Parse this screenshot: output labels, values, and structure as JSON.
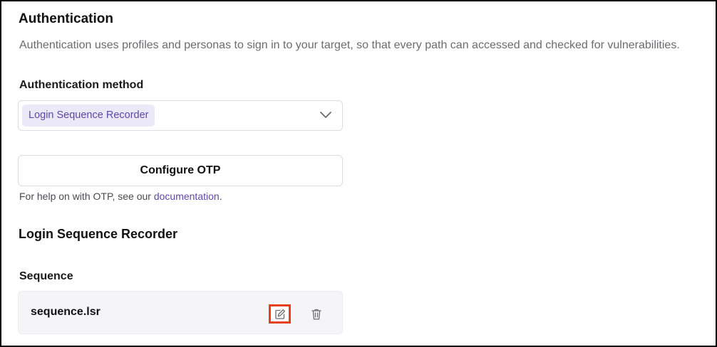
{
  "authentication": {
    "title": "Authentication",
    "description": "Authentication uses profiles and personas to sign in to your target, so that every path can accessed and checked for vulnerabilities.",
    "method_label": "Authentication method",
    "method_selected": "Login Sequence Recorder",
    "configure_otp_label": "Configure OTP",
    "help_prefix": "For help on with OTP, see our ",
    "help_link": "documentation",
    "help_suffix": "."
  },
  "recorder": {
    "title": "Login Sequence Recorder",
    "sequence_label": "Sequence",
    "sequence_file": "sequence.lsr"
  },
  "icons": {
    "select_chevron": "chevron-down-icon",
    "edit": "edit-icon",
    "delete": "trash-icon"
  },
  "colors": {
    "accent": "#5b48a8",
    "chip_bg": "#ebe9f7",
    "highlight": "#e8401c"
  }
}
